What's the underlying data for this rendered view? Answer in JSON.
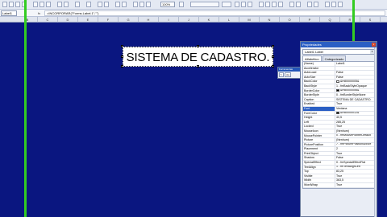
{
  "toolbar": {
    "zoom": "100%"
  },
  "formula_bar": {
    "name_box": "Label1",
    "fx": "fx",
    "formula": "=INCORPORAR(\"Forms.Label.1\";\"\")"
  },
  "columns": [
    "B",
    "C",
    "D",
    "E",
    "F",
    "G",
    "H",
    "I",
    "J",
    "K",
    "L",
    "M",
    "N",
    "O",
    "P",
    "Q",
    "R",
    "S"
  ],
  "banner": {
    "text": "SISTEMA DE CADASTRO."
  },
  "toolbox": {
    "title": "Ferramentas",
    "tool1": "↖",
    "tool2": "Aa"
  },
  "properties": {
    "title": "Propriedades",
    "close": "x",
    "object": "Label1 Label",
    "tab_alpha": "Alfabético",
    "tab_categorized": "Categorizado",
    "rows": [
      {
        "name": "(Name)",
        "value": "Label1"
      },
      {
        "name": "Accelerator",
        "value": ""
      },
      {
        "name": "AutoLoad",
        "value": "False"
      },
      {
        "name": "AutoSize",
        "value": "False"
      },
      {
        "name": "BackColor",
        "value": "&H80000005&",
        "color": "#ffffff"
      },
      {
        "name": "BackStyle",
        "value": "1 - fmBackStyleOpaque"
      },
      {
        "name": "BorderColor",
        "value": "&H80000006&",
        "color": "#000000"
      },
      {
        "name": "BorderStyle",
        "value": "0 - fmBorderStyleNone"
      },
      {
        "name": "Caption",
        "value": "SISTEMA DE CADASTRO."
      },
      {
        "name": "Enabled",
        "value": "True"
      },
      {
        "name": "Font",
        "value": "Verdana",
        "selected": true
      },
      {
        "name": "ForeColor",
        "value": "&H80000012&",
        "color": "#000000"
      },
      {
        "name": "Height",
        "value": "40,5"
      },
      {
        "name": "Left",
        "value": "285,25"
      },
      {
        "name": "Locked",
        "value": "True"
      },
      {
        "name": "MouseIcon",
        "value": "(Nenhum)"
      },
      {
        "name": "MousePointer",
        "value": "0 - fmMousePointerDefault"
      },
      {
        "name": "Picture",
        "value": "(Nenhum)"
      },
      {
        "name": "PicturePosition",
        "value": "7 - fmPicturePositionAbove"
      },
      {
        "name": "Placement",
        "value": "2"
      },
      {
        "name": "PrintObject",
        "value": "True"
      },
      {
        "name": "Shadow",
        "value": "False"
      },
      {
        "name": "SpecialEffect",
        "value": "0 - fmSpecialEffectFlat"
      },
      {
        "name": "TextAlign",
        "value": "1 - fmTextAlignLeft"
      },
      {
        "name": "Top",
        "value": "83,25"
      },
      {
        "name": "Visible",
        "value": "True"
      },
      {
        "name": "Width",
        "value": "363,5"
      },
      {
        "name": "WordWrap",
        "value": "True"
      }
    ]
  },
  "colors": {
    "sheet_background": "#0a1680",
    "guide_lines": "#33cc22",
    "title_bar": "#2b5fc4"
  }
}
